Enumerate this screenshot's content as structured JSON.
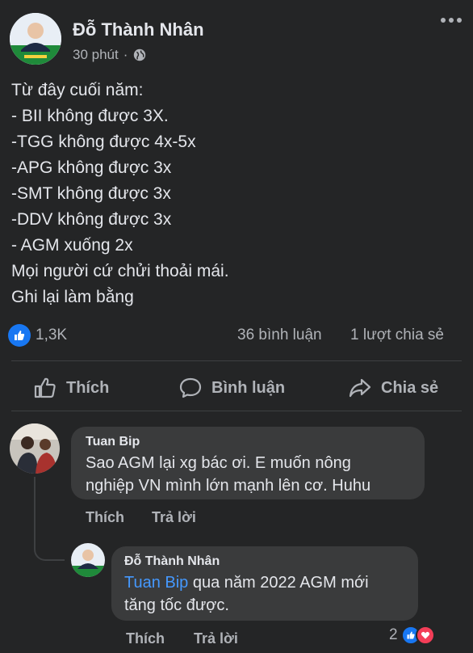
{
  "post": {
    "author": "Đỗ Thành Nhân",
    "time": "30 phút",
    "separator": "·",
    "privacy_icon": "globe-icon",
    "more_icon": "more-dots-icon",
    "lines": [
      "Từ đây cuối năm:",
      "- BII không được 3X.",
      "-TGG không được 4x-5x",
      "-APG không được 3x",
      "-SMT không được 3x",
      "-DDV không được 3x",
      "- AGM xuống 2x",
      "Mọi người cứ chửi thoải mái.",
      "Ghi lại làm bằng"
    ]
  },
  "stats": {
    "reaction_icon": "like-icon",
    "reactions": "1,3K",
    "comments": "36 bình luận",
    "shares": "1 lượt chia sẻ"
  },
  "actions": {
    "like": "Thích",
    "comment": "Bình luận",
    "share": "Chia sẻ"
  },
  "comments": [
    {
      "author": "Tuan Bip",
      "lines": [
        "Sao AGM lại xg bác ơi. E muốn nông",
        "nghiệp VN mình lớn mạnh lên cơ. Huhu"
      ],
      "like": "Thích",
      "reply": "Trả lời",
      "reply_item": {
        "author": "Đỗ Thành Nhân",
        "mention": "Tuan Bip",
        "line1_rest": " qua năm 2022 AGM mới",
        "line2": "tăng tốc được.",
        "like": "Thích",
        "reply": "Trả lời",
        "reaction_count": "2",
        "reaction_icons": [
          "like-icon",
          "love-icon"
        ]
      }
    }
  ],
  "colors": {
    "background": "#242526",
    "bubble": "#3a3b3c",
    "text": "#e4e6eb",
    "secondary": "#b0b3b8",
    "accent_blue": "#1877f2",
    "mention": "#4599ff",
    "love_red": "#f33e58"
  }
}
